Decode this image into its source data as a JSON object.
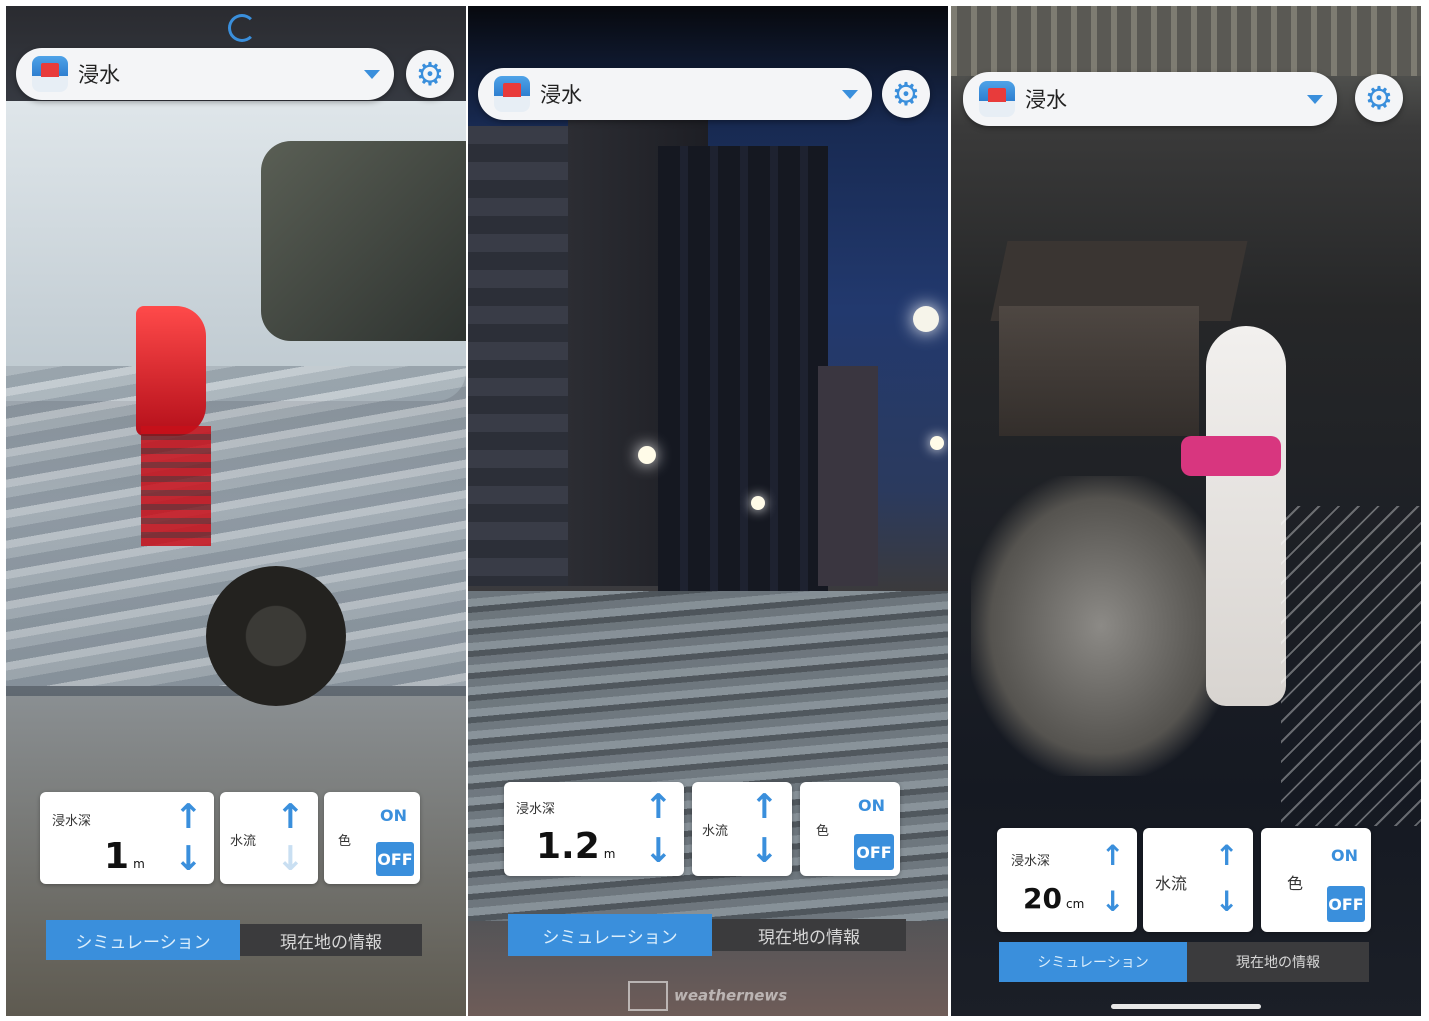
{
  "screens": [
    {
      "app_title": "浸水",
      "depth_label": "浸水深",
      "depth_value": "1",
      "depth_unit": "m",
      "flow_label": "水流",
      "color_label": "色",
      "on_label": "ON",
      "off_label": "OFF",
      "tab_simulation": "シミュレーション",
      "tab_location": "現在地の情報"
    },
    {
      "app_title": "浸水",
      "depth_label": "浸水深",
      "depth_value": "1.2",
      "depth_unit": "m",
      "flow_label": "水流",
      "color_label": "色",
      "on_label": "ON",
      "off_label": "OFF",
      "tab_simulation": "シミュレーション",
      "tab_location": "現在地の情報"
    },
    {
      "app_title": "浸水",
      "depth_label": "浸水深",
      "depth_value": "20",
      "depth_unit": "cm",
      "flow_label": "水流",
      "color_label": "色",
      "on_label": "ON",
      "off_label": "OFF",
      "tab_simulation": "シミュレーション",
      "tab_location": "現在地の情報"
    }
  ],
  "watermark": "weathernews",
  "icons": {
    "settings": "gear-icon",
    "dropdown": "chevron-down-icon",
    "increase": "arrow-up-icon",
    "decrease": "arrow-down-icon"
  },
  "colors": {
    "accent": "#3a8fdc",
    "tab_inactive": "#3b3b3d",
    "panel": "#ffffff"
  }
}
